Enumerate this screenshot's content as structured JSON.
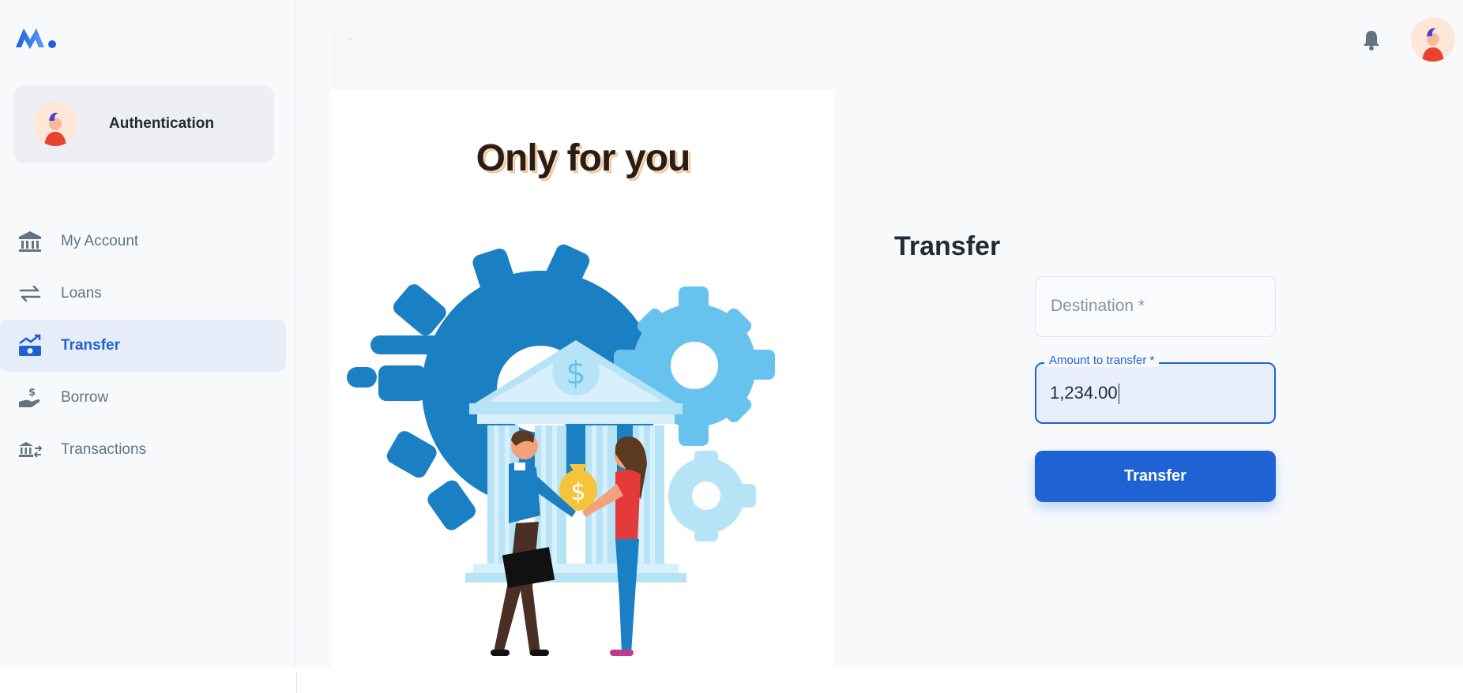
{
  "brand": {
    "logo_icon": "m-logo-icon",
    "logo_color": "#1f62d4"
  },
  "account_card": {
    "name": "Authentication",
    "avatar_icon": "user-avatar-icon"
  },
  "sidebar": {
    "items": [
      {
        "label": "My Account",
        "icon": "bank-icon",
        "active": false
      },
      {
        "label": "Loans",
        "icon": "arrows-exchange-icon",
        "active": false
      },
      {
        "label": "Transfer",
        "icon": "money-transfer-icon",
        "active": true
      },
      {
        "label": "Borrow",
        "icon": "hand-dollar-icon",
        "active": false
      },
      {
        "label": "Transactions",
        "icon": "bank-transfer-icon",
        "active": false
      }
    ]
  },
  "header": {
    "notification_icon": "bell-icon",
    "avatar_icon": "user-avatar-icon"
  },
  "promo": {
    "title": "Only for you",
    "illustration": "bank-handshake-illustration"
  },
  "form": {
    "title": "Transfer",
    "destination": {
      "placeholder": "Destination *",
      "value": ""
    },
    "amount": {
      "label": "Amount to transfer *",
      "value": "1,234.00"
    },
    "submit_label": "Transfer"
  },
  "colors": {
    "accent": "#1f62d4",
    "active_bg": "#e6edf8",
    "text_muted": "#637381"
  }
}
